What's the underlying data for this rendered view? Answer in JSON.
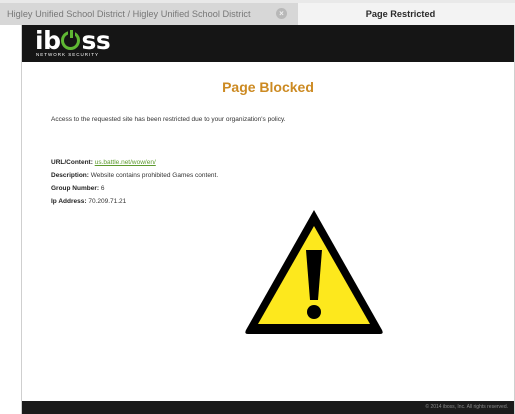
{
  "browser": {
    "tabs": [
      {
        "label": "Higley Unified School District / Higley Unified School District",
        "active": false
      },
      {
        "label": "Page Restricted",
        "active": true
      }
    ],
    "close_glyph": "×"
  },
  "header": {
    "logo_text_prefix": "ib",
    "logo_text_suffix": "ss",
    "tagline": "NETWORK SECURITY",
    "logo_color": "#ffffff",
    "accent_color": "#5fb833"
  },
  "main": {
    "title": "Page Blocked",
    "title_color": "#cc8a22",
    "message": "Access to the requested site has been restricted due to your organization's policy.",
    "details": [
      {
        "label": "URL/Content:",
        "value": "us.battle.net/wow/en/",
        "is_link": true
      },
      {
        "label": "Description:",
        "value": "Website contains prohibited Games content."
      },
      {
        "label": "Group Number:",
        "value": "6"
      },
      {
        "label": "Ip Address:",
        "value": "70.209.71.21"
      }
    ],
    "warning_icon": "warning-triangle-icon"
  },
  "footer": {
    "copyright": "© 2014 iboss, Inc. All rights reserved."
  }
}
